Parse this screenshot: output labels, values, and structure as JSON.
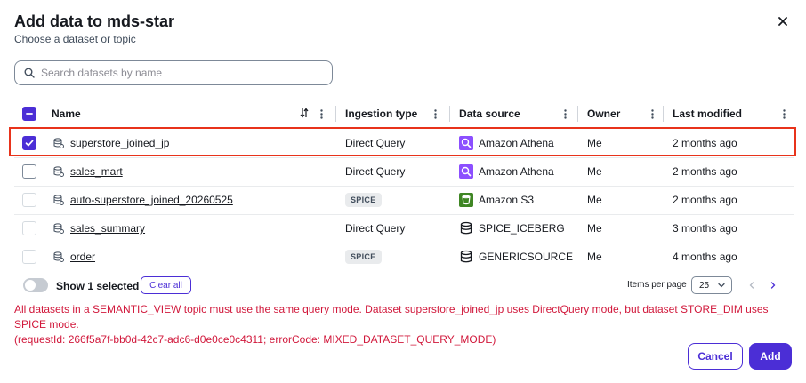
{
  "modal": {
    "title": "Add data to mds-star",
    "subtitle": "Choose a dataset or topic"
  },
  "search": {
    "placeholder": "Search datasets by name",
    "value": ""
  },
  "table": {
    "columns": {
      "name": "Name",
      "ingestion": "Ingestion type",
      "datasource": "Data source",
      "owner": "Owner",
      "modified": "Last modified"
    },
    "rows": [
      {
        "name": "superstore_joined_jp",
        "ingestion": "Direct Query",
        "source_icon": "athena-icon",
        "source": "Amazon Athena",
        "owner": "Me",
        "modified": "2 months ago",
        "checked": true,
        "disabled": false
      },
      {
        "name": "sales_mart",
        "ingestion": "Direct Query",
        "source_icon": "athena-icon",
        "source": "Amazon Athena",
        "owner": "Me",
        "modified": "2 months ago",
        "checked": false,
        "disabled": false
      },
      {
        "name": "auto-superstore_joined_20260525",
        "ingestion": "SPICE",
        "source_icon": "s3-icon",
        "source": "Amazon S3",
        "owner": "Me",
        "modified": "2 months ago",
        "checked": false,
        "disabled": true
      },
      {
        "name": "sales_summary",
        "ingestion": "Direct Query",
        "source_icon": "database-icon",
        "source": "SPICE_ICEBERG",
        "owner": "Me",
        "modified": "3 months ago",
        "checked": false,
        "disabled": true
      },
      {
        "name": "order",
        "ingestion": "SPICE",
        "source_icon": "database-icon",
        "source": "GENERICSOURCE",
        "owner": "Me",
        "modified": "4 months ago",
        "checked": false,
        "disabled": true
      }
    ]
  },
  "footer": {
    "toggle_label": "Show 1 selected",
    "clear_label": "Clear all",
    "items_per_page_label": "Items per page",
    "items_per_page": "25"
  },
  "error": {
    "line1": "All datasets in a SEMANTIC_VIEW topic must use the same query mode. Dataset superstore_joined_jp uses DirectQuery mode, but dataset STORE_DIM uses SPICE mode.",
    "line2": "(requestId: 266f5a7f-bb0d-42c7-adc6-d0e0ce0c4311; errorCode: MIXED_DATASET_QUERY_MODE)"
  },
  "actions": {
    "cancel": "Cancel",
    "add": "Add"
  },
  "colors": {
    "accent": "#4b2ed6",
    "error": "#d1183b",
    "highlight": "#e8331b",
    "athena": "#8c4fff",
    "s3": "#3f8624"
  }
}
